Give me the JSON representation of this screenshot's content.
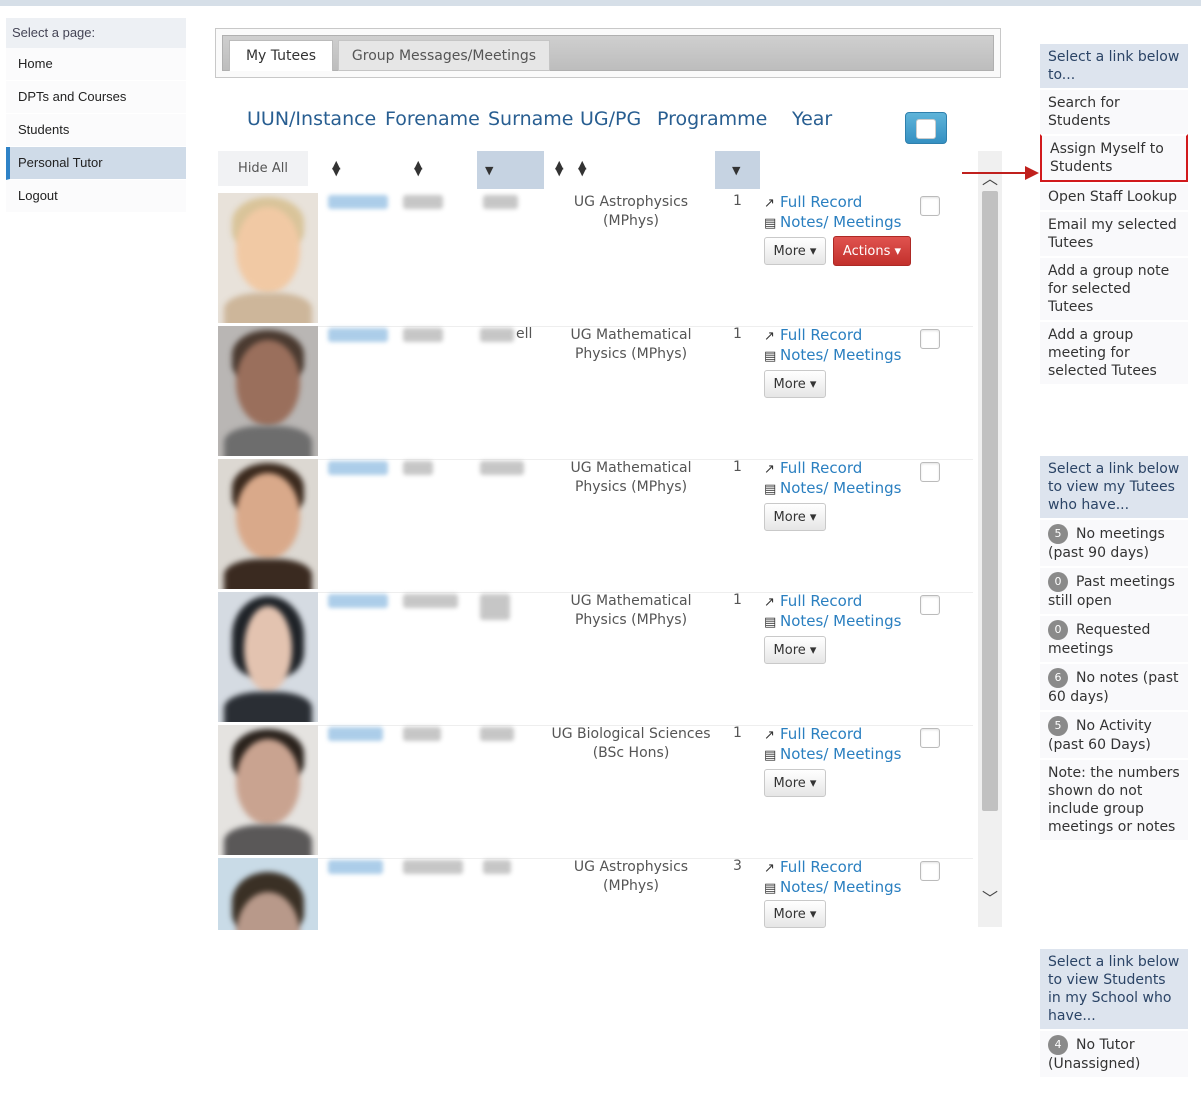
{
  "left_nav": {
    "header": "Select a page:",
    "items": [
      "Home",
      "DPTs and Courses",
      "Students",
      "Personal Tutor",
      "Logout"
    ],
    "active": "Personal Tutor"
  },
  "tabs": [
    "My Tutees",
    "Group Messages/Meetings"
  ],
  "columns": [
    "UUN/Instance",
    "Forename",
    "Surname",
    "UG/PG",
    "Programme",
    "Year"
  ],
  "filter": {
    "hide_all": "Hide All"
  },
  "rows": [
    {
      "programme": "UG Astrophysics (MPhys)",
      "year": "1",
      "has_actions": true
    },
    {
      "programme": "UG Mathematical Physics (MPhys)",
      "year": "1",
      "surname_fragment": "ell"
    },
    {
      "programme": "UG Mathematical Physics (MPhys)",
      "year": "1"
    },
    {
      "programme": "UG Mathematical Physics (MPhys)",
      "year": "1"
    },
    {
      "programme": "UG Biological Sciences (BSc Hons)",
      "year": "1"
    },
    {
      "programme": "UG Astrophysics (MPhys)",
      "year": "3"
    }
  ],
  "row_labels": {
    "full_record": "Full Record",
    "notes_meetings": "Notes/ Meetings",
    "more": "More",
    "actions": "Actions"
  },
  "right_panels": {
    "links": {
      "header": "Select a link below to...",
      "items": [
        "Search for Students",
        "Assign Myself to Students",
        "Open Staff Lookup",
        "Email my selected Tutees",
        "Add a group note for selected Tutees",
        "Add a group meeting for selected Tutees"
      ]
    },
    "tutees": {
      "header": "Select a link below to view my Tutees who have...",
      "items": [
        {
          "count": "5",
          "label": "No meetings (past 90 days)"
        },
        {
          "count": "0",
          "label": "Past meetings still open"
        },
        {
          "count": "0",
          "label": "Requested meetings"
        },
        {
          "count": "6",
          "label": "No notes (past 60 days)"
        },
        {
          "count": "5",
          "label": "No Activity (past 60 Days)"
        }
      ],
      "note": "Note: the numbers shown do not include group meetings or notes"
    },
    "school": {
      "header": "Select a link below to view Students in my School who have...",
      "items": [
        {
          "count": "4",
          "label": "No Tutor (Unassigned)"
        }
      ]
    }
  },
  "colors": {
    "accent": "#2a7fc0",
    "highlight": "#d1191c",
    "actions": "#d9534f"
  }
}
